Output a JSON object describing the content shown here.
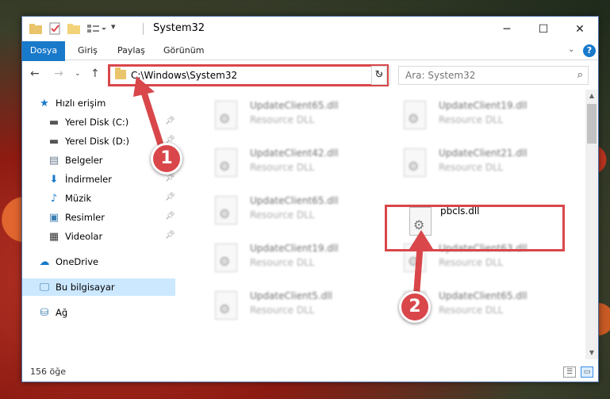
{
  "window": {
    "title": "System32"
  },
  "ribbon": {
    "tabs": [
      {
        "label": "Dosya"
      },
      {
        "label": "Giriş"
      },
      {
        "label": "Paylaş"
      },
      {
        "label": "Görünüm"
      }
    ]
  },
  "address": {
    "path": "C:\\Windows\\System32"
  },
  "search": {
    "placeholder": "Ara: System32"
  },
  "nav": {
    "items": [
      {
        "label": "Hızlı erişim",
        "icon": "star-icon"
      },
      {
        "label": "Yerel Disk (C:)",
        "icon": "drive-icon"
      },
      {
        "label": "Yerel Disk (D:)",
        "icon": "drive-icon"
      },
      {
        "label": "Belgeler",
        "icon": "document-icon"
      },
      {
        "label": "İndirmeler",
        "icon": "download-icon"
      },
      {
        "label": "Müzik",
        "icon": "music-icon"
      },
      {
        "label": "Resimler",
        "icon": "picture-icon"
      },
      {
        "label": "Videolar",
        "icon": "video-icon"
      },
      {
        "label": "OneDrive",
        "icon": "cloud-icon"
      },
      {
        "label": "Bu bilgisayar",
        "icon": "computer-icon"
      },
      {
        "label": "Ağ",
        "icon": "network-icon"
      }
    ]
  },
  "files": [
    {
      "name": "UpdateClient65.dll",
      "type": "Resource DLL"
    },
    {
      "name": "UpdateClient19.dll",
      "type": "Resource DLL"
    },
    {
      "name": "UpdateClient42.dll",
      "type": "Resource DLL"
    },
    {
      "name": "UpdateClient21.dll",
      "type": "Resource DLL"
    },
    {
      "name": "UpdateClient65.dll",
      "type": "Resource DLL"
    },
    {
      "name": "pbcls.dll",
      "type": ""
    },
    {
      "name": "UpdateClient19.dll",
      "type": "Resource DLL"
    },
    {
      "name": "UpdateClient63.dll",
      "type": "Resource DLL"
    },
    {
      "name": "UpdateClient5.dll",
      "type": "Resource DLL"
    },
    {
      "name": "UpdateClient65.dll",
      "type": "Resource DLL"
    }
  ],
  "status": {
    "count": "156 öğe"
  },
  "annotations": {
    "step1": "1",
    "step2": "2"
  },
  "colors": {
    "accent": "#1979ca",
    "highlight": "#d9474a",
    "selection": "#cce8ff"
  }
}
